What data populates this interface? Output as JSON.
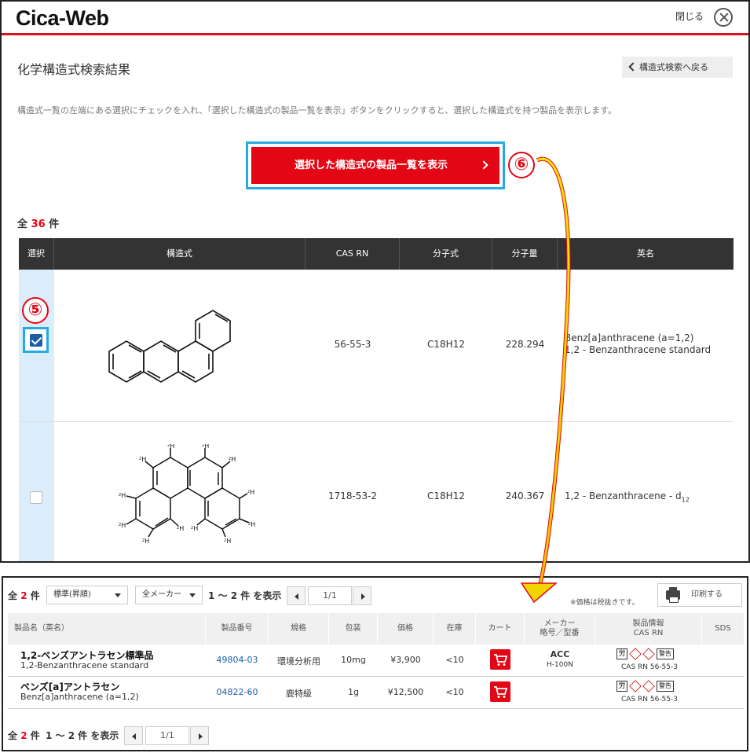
{
  "header": {
    "logo": "Cica-Web",
    "close_label": "閉じる"
  },
  "page": {
    "title": "化学構造式検索結果",
    "back_label": "構造式検索へ戻る",
    "instruction": "構造式一覧の左端にある選択にチェックを入れ、「選択した構造式の製品一覧を表示」ボタンをクリックすると、選択した構造式を持つ製品を表示します。",
    "show_button_label": "選択した構造式の製品一覧を表示",
    "count_prefix": "全 ",
    "count_value": "36",
    "count_suffix": " 件",
    "step_badges": [
      "⑤",
      "⑥"
    ]
  },
  "structure_table": {
    "columns": [
      "選択",
      "構造式",
      "CAS RN",
      "分子式",
      "分子量",
      "英名"
    ],
    "rows": [
      {
        "selected": true,
        "cas": "56-55-3",
        "formula": "C18H12",
        "mw": "228.294",
        "name_line1": "Benz[a]anthracene (a=1,2)",
        "name_line2": "1,2 - Benzanthracene standard"
      },
      {
        "selected": false,
        "cas": "1718-53-2",
        "formula": "C18H12",
        "mw": "240.367",
        "name_line1": "1,2 - Benzanthracene - d",
        "name_sub": "12",
        "atom_label": "H",
        "atom_isotope": "2"
      }
    ]
  },
  "products": {
    "count_prefix": "全",
    "count_value": "2",
    "count_suffix": "件",
    "sort_select": "標準(昇順)",
    "maker_select": "全メーカー",
    "range_text": "1 〜 2 件 を表示",
    "page_value": "1/1",
    "tax_note": "※価格は税抜きです。",
    "print_label": "印刷する",
    "columns": [
      "製品名（英名）",
      "製品番号",
      "規格",
      "包装",
      "価格",
      "在庫",
      "カート",
      "メーカー\n略号／型番",
      "製品情報\nCAS RN",
      "SDS"
    ],
    "rows": [
      {
        "name": "1,2-ベンズアントラセン標準品",
        "sub": "1,2-Benzanthracene standard",
        "code": "49804-03",
        "grade": "環境分析用",
        "pack": "10mg",
        "price": "¥3,900",
        "stock": "<10",
        "maker": "ACC",
        "maker_model": "H-100N",
        "hazard_labels": [
          "労",
          "警告"
        ],
        "cas": "CAS RN 56-55-3"
      },
      {
        "name": "ベンズ[a]アントラセン",
        "sub": "Benz[a]anthracene (a=1,2)",
        "code": "04822-60",
        "grade": "鹿特級",
        "pack": "1g",
        "price": "¥12,500",
        "stock": "<10",
        "maker": "",
        "maker_model": "",
        "hazard_labels": [
          "労",
          "警告"
        ],
        "cas": "CAS RN 56-55-3"
      }
    ],
    "footer_count_prefix": "全",
    "footer_count_value": "2",
    "footer_count_suffix": "件",
    "footer_range_text": "1 〜 2 件 を表示",
    "footer_page_value": "1/1"
  },
  "colors": {
    "brand_red": "#e30614",
    "highlight_blue": "#29a9e1",
    "link_blue": "#1a5ea8",
    "header_dark": "#333333"
  }
}
